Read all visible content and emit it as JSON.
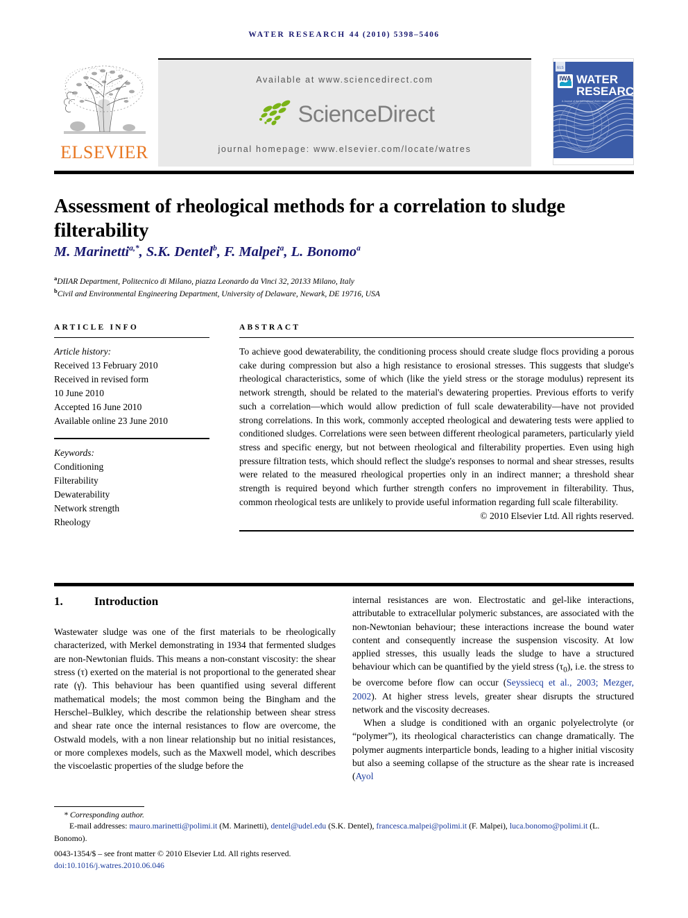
{
  "running_head": {
    "journal": "WATER RESEARCH",
    "volume_pages": "44 (2010) 5398–5406"
  },
  "masthead": {
    "publisher_logo_text": "ELSEVIER",
    "available_at": "Available at www.sciencedirect.com",
    "sciencedirect_wordmark": "ScienceDirect",
    "journal_homepage": "journal homepage: www.elsevier.com/locate/watres",
    "cover": {
      "society_abbr": "IWA",
      "title_line1": "WATER",
      "title_line2": "RESEARCH",
      "tagline": "A Journal of the International Water Association"
    },
    "colors": {
      "elsevier_orange": "#E87722",
      "banner_grey": "#e9e9e9",
      "sd_green": "#7ab317",
      "cover_blue": "#3b5ca8"
    }
  },
  "article": {
    "title": "Assessment of rheological methods for a correlation to sludge filterability",
    "authors_html": "M. Marinetti<sup>a,*</sup>, S.K. Dentel<sup>b</sup>, F. Malpei<sup>a</sup>, L. Bonomo<sup>a</sup>",
    "affiliations": [
      {
        "mark": "a",
        "text": "DIIAR Department, Politecnico di Milano, piazza Leonardo da Vinci 32, 20133 Milano, Italy"
      },
      {
        "mark": "b",
        "text": "Civil and Environmental Engineering Department, University of Delaware, Newark, DE 19716, USA"
      }
    ]
  },
  "article_info": {
    "heading": "ARTICLE INFO",
    "history_label": "Article history:",
    "history": [
      "Received 13 February 2010",
      "Received in revised form",
      "10 June 2010",
      "Accepted 16 June 2010",
      "Available online 23 June 2010"
    ],
    "keywords_label": "Keywords:",
    "keywords": [
      "Conditioning",
      "Filterability",
      "Dewaterability",
      "Network strength",
      "Rheology"
    ]
  },
  "abstract": {
    "heading": "ABSTRACT",
    "text": "To achieve good dewaterability, the conditioning process should create sludge flocs providing a porous cake during compression but also a high resistance to erosional stresses. This suggests that sludge's rheological characteristics, some of which (like the yield stress or the storage modulus) represent its network strength, should be related to the material's dewatering properties. Previous efforts to verify such a correlation—which would allow prediction of full scale dewaterability—have not provided strong correlations. In this work, commonly accepted rheological and dewatering tests were applied to conditioned sludges. Correlations were seen between different rheological parameters, particularly yield stress and specific energy, but not between rheological and filterability properties. Even using high pressure filtration tests, which should reflect the sludge's responses to normal and shear stresses, results were related to the measured rheological properties only in an indirect manner; a threshold shear strength is required beyond which further strength confers no improvement in filterability. Thus, common rheological tests are unlikely to provide useful information regarding full scale filterability.",
    "copyright": "© 2010 Elsevier Ltd. All rights reserved."
  },
  "introduction": {
    "number": "1.",
    "heading": "Introduction",
    "left_paragraph": "Wastewater sludge was one of the first materials to be rheologically characterized, with Merkel demonstrating in 1934 that fermented sludges are non-Newtonian fluids. This means a non-constant viscosity: the shear stress (τ) exerted on the material is not proportional to the generated shear rate (γ̇). This behaviour has been quantified using several different mathematical models; the most common being the Bingham and the Herschel–Bulkley, which describe the relationship between shear stress and shear rate once the internal resistances to flow are overcome, the Ostwald models, with a non linear relationship but no initial resistances, or more complexes models, such as the Maxwell model, which describes the viscoelastic properties of the sludge before the",
    "right_paragraph_1_a": "internal resistances are won. Electrostatic and gel-like interactions, attributable to extracellular polymeric substances, are associated with the non-Newtonian behaviour; these interactions increase the bound water content and consequently increase the suspension viscosity. At low applied stresses, this usually leads the sludge to have a structured behaviour which can be quantified by the yield stress (τ",
    "right_paragraph_1_sub": "0",
    "right_paragraph_1_b": "), i.e. the stress to be overcome before flow can occur (",
    "citation_1": "Seyssiecq et al., 2003; Mezger, 2002",
    "right_paragraph_1_c": "). At higher stress levels, greater shear disrupts the structured network and the viscosity decreases.",
    "right_paragraph_2_a": "When a sludge is conditioned with an organic polyelectrolyte (or “polymer”), its rheological characteristics can change dramatically. The polymer augments interparticle bonds, leading to a higher initial viscosity but also a seeming collapse of the structure as the shear rate is increased (",
    "citation_2": "Ayol"
  },
  "footnote": {
    "corresponding": "* Corresponding author.",
    "emails_label": "E-mail addresses:",
    "emails": [
      {
        "address": "mauro.marinetti@polimi.it",
        "name": "(M. Marinetti)"
      },
      {
        "address": "dentel@udel.edu",
        "name": "(S.K. Dentel)"
      },
      {
        "address": "francesca.malpei@polimi.it",
        "name": "(F. Malpei)"
      },
      {
        "address": "luca.bonomo@polimi.it",
        "name": "(L. Bonomo)."
      }
    ],
    "front_matter": "0043-1354/$ – see front matter © 2010 Elsevier Ltd. All rights reserved.",
    "doi": "doi:10.1016/j.watres.2010.06.046"
  }
}
